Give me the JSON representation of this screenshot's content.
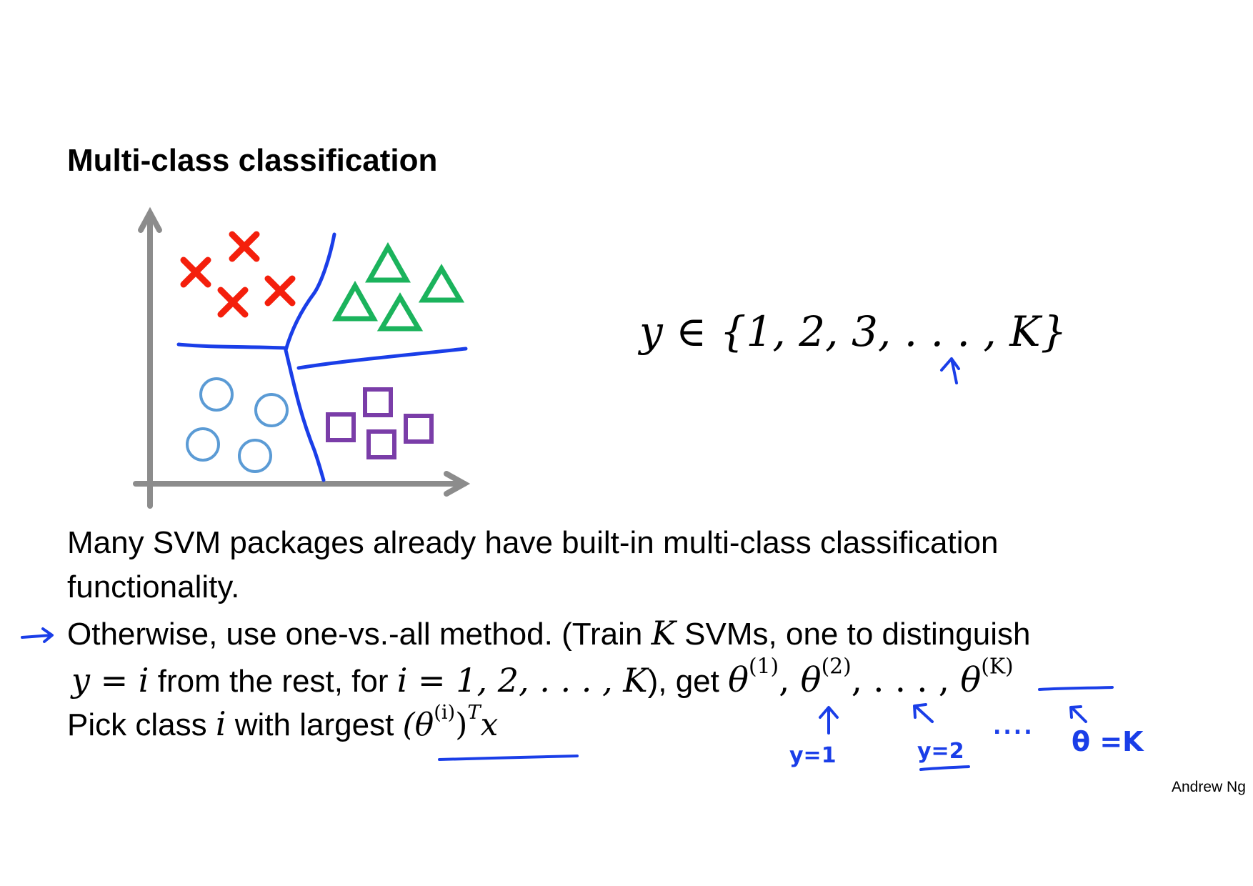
{
  "slide": {
    "title": "Multi-class classification",
    "set_expression": "y ∈ {1, 2, 3, . . . , K}",
    "line1": "Many SVM packages already have built-in multi-class classification",
    "line2": "functionality.",
    "line3_a": "Otherwise, use one-vs.-all method. (Train ",
    "line3_K": "K",
    "line3_b": " SVMs, one to distinguish",
    "line4_y_eq_i": "y = i",
    "line4_a": " from the rest, for ",
    "line4_i_range": "i = 1, 2, . . . , K",
    "line4_b": "), get ",
    "theta_list": {
      "theta": "θ",
      "sup1": "(1)",
      "sup2": "(2)",
      "dots": ", . . . , ",
      "supK": "(K)"
    },
    "line5_a": "Pick class ",
    "line5_i": "i",
    "line5_b": " with largest ",
    "line5_expr_open": "(θ",
    "line5_expr_sup_i": "(i)",
    "line5_expr_close": ")",
    "line5_expr_sup_T": "T",
    "line5_expr_x": "x",
    "footer": "Andrew Ng"
  },
  "annotations": {
    "y_eq_1": "y=1",
    "y_eq_2": "y=2",
    "dots": "....",
    "theta_eq_K": "θ =K",
    "ink_color": "#1a3ee8"
  },
  "figure": {
    "colors": {
      "axis": "#8c8c8c",
      "boundary": "#1a3ee8",
      "cross": "#f41f0c",
      "triangle": "#1bb35c",
      "circle": "#5b9bd5",
      "square": "#7a3da8"
    }
  }
}
